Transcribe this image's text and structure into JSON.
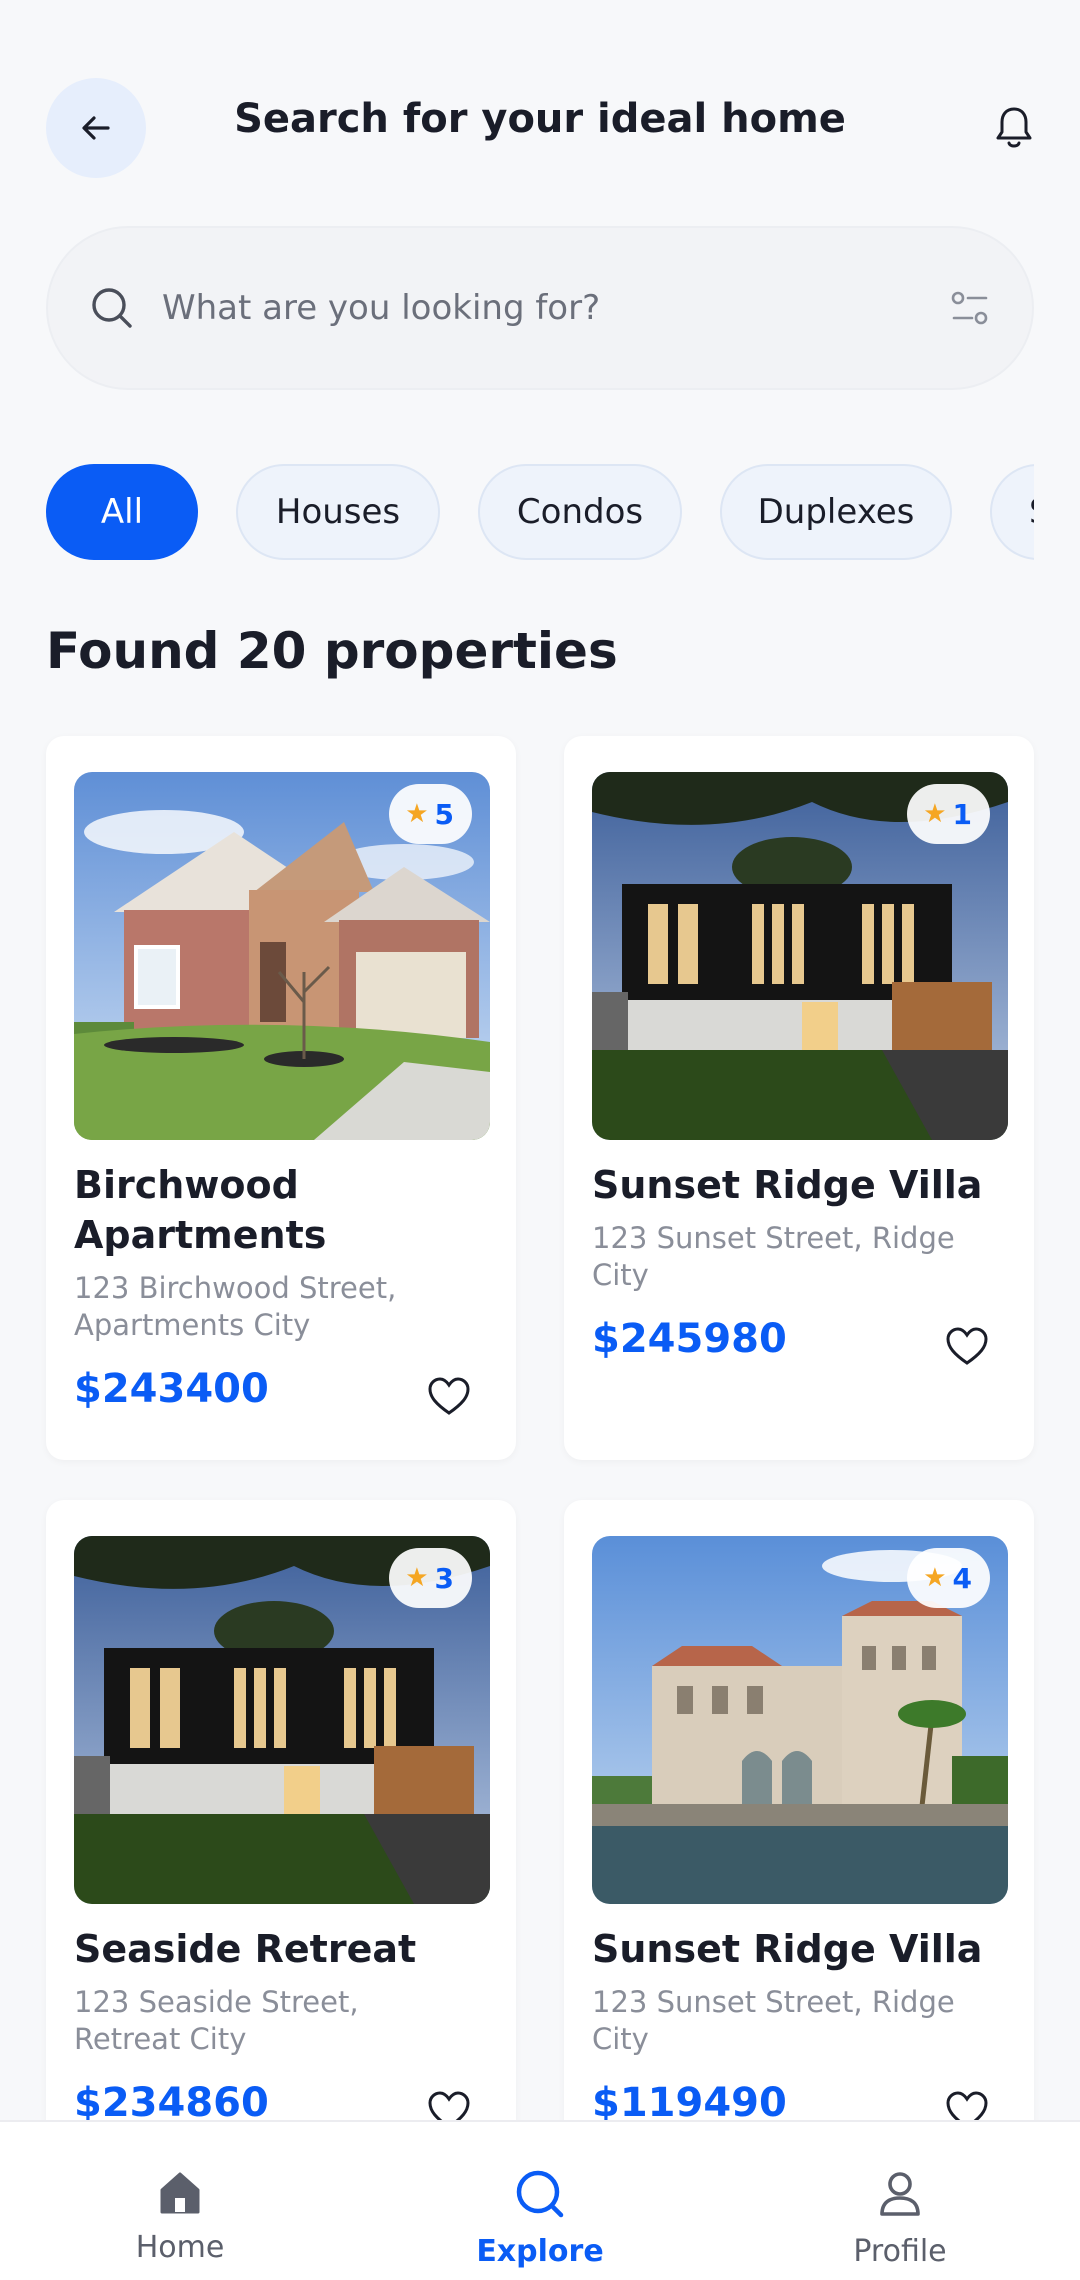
{
  "header": {
    "title": "Search for your ideal home",
    "back_icon": "arrow-left-icon",
    "bell_icon": "bell-icon"
  },
  "search": {
    "placeholder": "What are you looking for?",
    "value": ""
  },
  "categories": [
    "All",
    "Houses",
    "Condos",
    "Duplexes",
    "Studios"
  ],
  "active_category": "All",
  "results_title": "Found 20 properties",
  "properties": [
    {
      "name": "Birchwood Apartments",
      "address": "123 Birchwood Street, Apartments City",
      "price": "$243400",
      "rating": "5",
      "photo": "brick suburban house"
    },
    {
      "name": "Sunset Ridge Villa",
      "address": "123 Sunset Street, Ridge City",
      "price": "$245980",
      "rating": "1",
      "photo": "modern black box house at dusk"
    },
    {
      "name": "Seaside Retreat",
      "address": "123 Seaside Street, Retreat City",
      "price": "$234860",
      "rating": "3",
      "photo": "modern black box house at dusk"
    },
    {
      "name": "Sunset Ridge Villa",
      "address": "123 Sunset Street, Ridge City",
      "price": "$119490",
      "rating": "4",
      "photo": "waterfront mansion"
    }
  ],
  "bottom_nav": [
    {
      "label": "Home",
      "icon": "home-icon"
    },
    {
      "label": "Explore",
      "icon": "search-icon",
      "active": true
    },
    {
      "label": "Profile",
      "icon": "user-icon"
    }
  ],
  "colors": {
    "accent": "#0a5cf5",
    "star": "#f5a623",
    "text": "#1a1d29",
    "muted": "#8a8e99"
  }
}
